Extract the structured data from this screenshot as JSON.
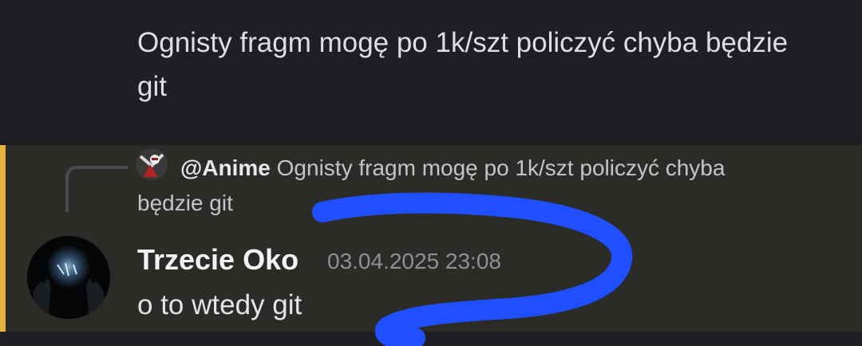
{
  "previous_message": {
    "text": "Ognisty fragm mogę po 1k/szt policzyć chyba będzie git"
  },
  "reply": {
    "author": "@Anime",
    "preview_line1": "Ognisty fragm mogę po 1k/szt policzyć chyba",
    "preview_line2": "będzie git"
  },
  "message": {
    "author": "Trzecie Oko",
    "timestamp": "03.04.2025 23:08",
    "text": "o to wtedy git"
  },
  "colors": {
    "background": "#1e1f23",
    "highlight_background": "#2b2b27",
    "mention_accent": "#e8b33a",
    "scribble": "#1f4fff"
  }
}
